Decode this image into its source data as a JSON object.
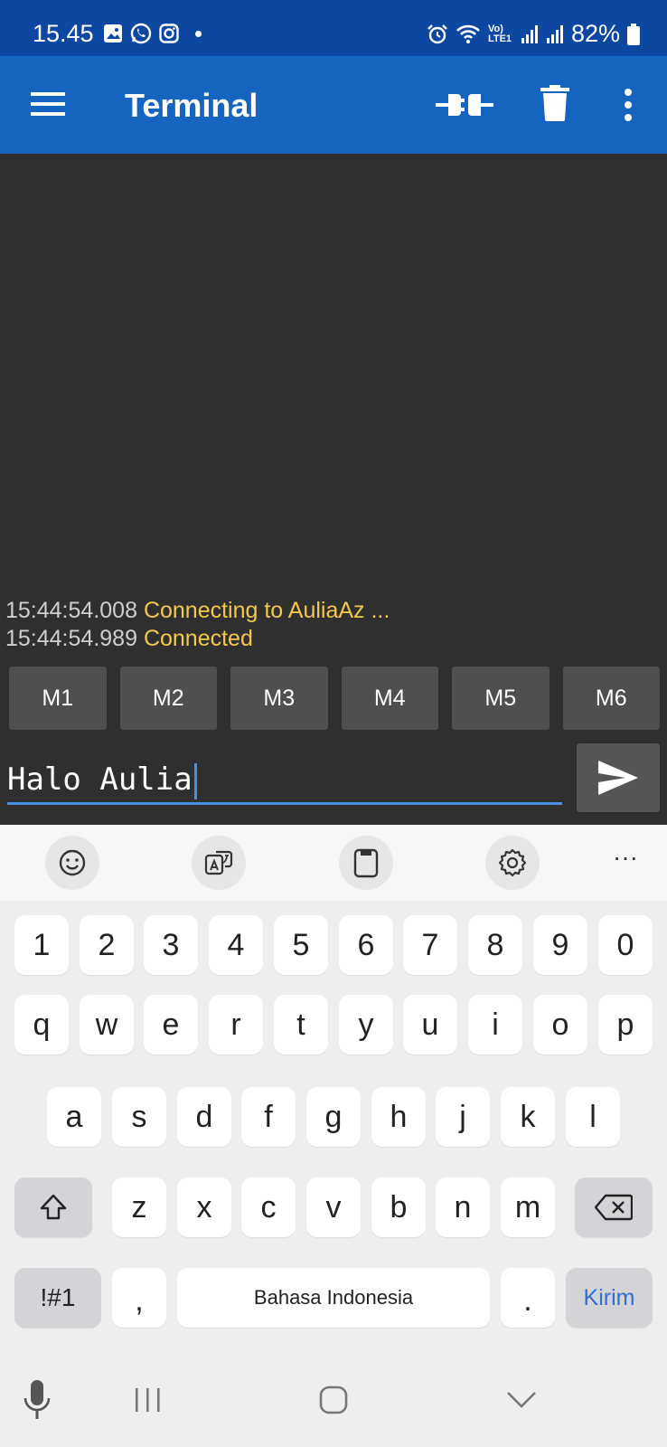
{
  "status_bar": {
    "time": "15.45",
    "notification_icons": [
      "gallery-icon",
      "whatsapp-icon",
      "instagram-icon",
      "dot-icon"
    ],
    "system_icons": [
      "alarm-icon",
      "wifi-icon",
      "volte-icon",
      "signal-icon",
      "signal-icon"
    ],
    "volte_label": "Vo) LTE1",
    "battery": "82%"
  },
  "app_bar": {
    "title": "Terminal",
    "actions": [
      "connect-icon",
      "delete-icon",
      "more-vert-icon"
    ]
  },
  "terminal": {
    "lines": [
      {
        "timestamp": "15:44:54.008",
        "message": "Connecting to AuliaAz ..."
      },
      {
        "timestamp": "15:44:54.989",
        "message": "Connected"
      }
    ],
    "colors": {
      "background": "#2f2f2f",
      "timestamp": "#cfcfcf",
      "status": "#f2c94c"
    }
  },
  "macros": [
    "M1",
    "M2",
    "M3",
    "M4",
    "M5",
    "M6"
  ],
  "input": {
    "value": "Halo Aulia"
  },
  "keyboard": {
    "toolbar": [
      "emoji-icon",
      "translate-icon",
      "clipboard-icon",
      "settings-icon",
      "more-horiz-icon"
    ],
    "more_label": "···",
    "row_numbers": [
      "1",
      "2",
      "3",
      "4",
      "5",
      "6",
      "7",
      "8",
      "9",
      "0"
    ],
    "row_1": [
      "q",
      "w",
      "e",
      "r",
      "t",
      "y",
      "u",
      "i",
      "o",
      "p"
    ],
    "row_2": [
      "a",
      "s",
      "d",
      "f",
      "g",
      "h",
      "j",
      "k",
      "l"
    ],
    "row_3": [
      "z",
      "x",
      "c",
      "v",
      "b",
      "n",
      "m"
    ],
    "symbols_label": "!#1",
    "comma_label": ",",
    "space_label": "Bahasa Indonesia",
    "period_label": ".",
    "enter_label": "Kirim",
    "accent_color": "#2f6fd6"
  },
  "nav_bar": [
    "mic-icon",
    "recents-icon",
    "home-icon",
    "hide-keyboard-icon"
  ]
}
